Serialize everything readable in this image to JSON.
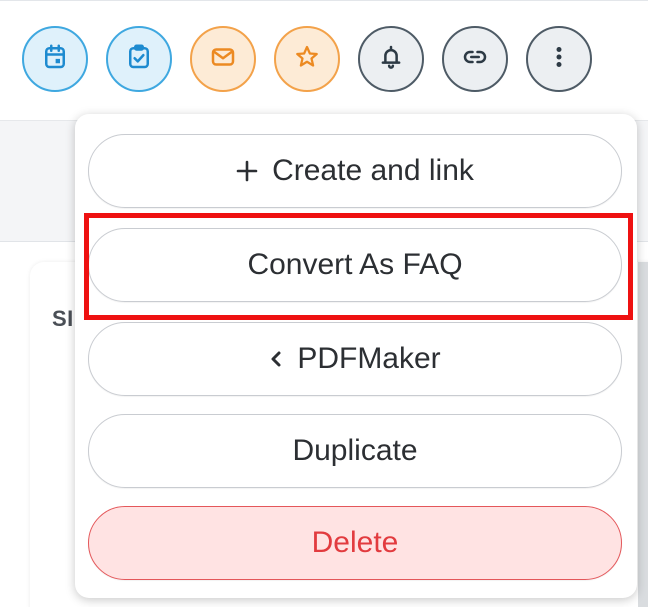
{
  "toolbar": {
    "buttons": [
      {
        "name": "calendar-icon",
        "color": "#3fa8e0"
      },
      {
        "name": "task-icon",
        "color": "#3fa8e0"
      },
      {
        "name": "mail-icon",
        "color": "#f3a24a"
      },
      {
        "name": "star-icon",
        "color": "#f3a24a"
      },
      {
        "name": "bell-icon",
        "color": "#4e5b66"
      },
      {
        "name": "link-icon",
        "color": "#4e5b66"
      },
      {
        "name": "more-vertical-icon",
        "color": "#4e5b66"
      }
    ]
  },
  "background": {
    "partial_label": "SI"
  },
  "menu": {
    "items": [
      {
        "label": "Create and link",
        "icon": "plus-icon"
      },
      {
        "label": "Convert As FAQ"
      },
      {
        "label": "PDFMaker",
        "icon": "chevron-left-icon"
      },
      {
        "label": "Duplicate"
      },
      {
        "label": "Delete",
        "color": "#e23b3f"
      }
    ],
    "highlight_color": "#ee1111"
  }
}
